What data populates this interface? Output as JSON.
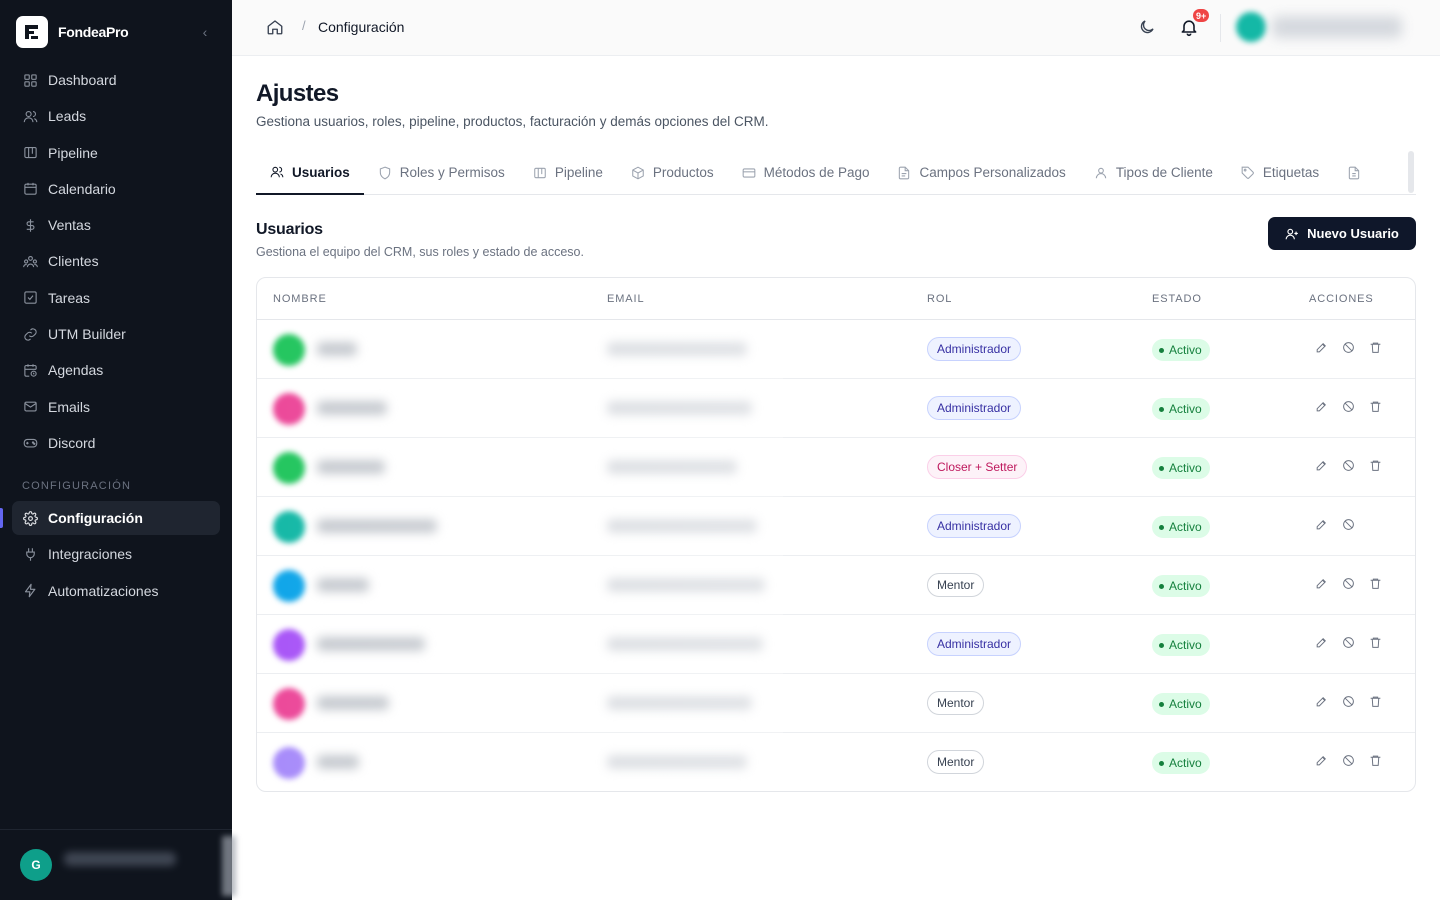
{
  "brand": {
    "name": "FondeaPro",
    "collapse_label": "‹"
  },
  "sidebar": {
    "items": [
      {
        "label": "Dashboard",
        "icon": "layout-grid-icon"
      },
      {
        "label": "Leads",
        "icon": "users-icon"
      },
      {
        "label": "Pipeline",
        "icon": "kanban-icon"
      },
      {
        "label": "Calendario",
        "icon": "calendar-icon"
      },
      {
        "label": "Ventas",
        "icon": "dollar-icon"
      },
      {
        "label": "Clientes",
        "icon": "contacts-icon"
      },
      {
        "label": "Tareas",
        "icon": "checklist-icon"
      },
      {
        "label": "UTM Builder",
        "icon": "link-icon"
      },
      {
        "label": "Agendas",
        "icon": "calendar-clock-icon"
      },
      {
        "label": "Emails",
        "icon": "mail-icon"
      },
      {
        "label": "Discord",
        "icon": "gamepad-icon"
      }
    ],
    "section_label": "CONFIGURACIÓN",
    "config_items": [
      {
        "label": "Configuración",
        "icon": "gear-icon",
        "active": true
      },
      {
        "label": "Integraciones",
        "icon": "plug-icon"
      },
      {
        "label": "Automatizaciones",
        "icon": "lightning-icon"
      }
    ],
    "footer": {
      "avatar_initial": "G"
    }
  },
  "topbar": {
    "breadcrumb_sep": "/",
    "breadcrumb_current": "Configuración",
    "notifications_badge": "9+"
  },
  "page": {
    "title": "Ajustes",
    "subtitle": "Gestiona usuarios, roles, pipeline, productos, facturación y demás opciones del CRM."
  },
  "tabs": [
    {
      "label": "Usuarios",
      "icon": "users-icon",
      "active": true
    },
    {
      "label": "Roles y Permisos",
      "icon": "shield-icon"
    },
    {
      "label": "Pipeline",
      "icon": "kanban-icon"
    },
    {
      "label": "Productos",
      "icon": "box-icon"
    },
    {
      "label": "Métodos de Pago",
      "icon": "credit-card-icon"
    },
    {
      "label": "Campos Personalizados",
      "icon": "file-icon"
    },
    {
      "label": "Tipos de Cliente",
      "icon": "user-icon"
    },
    {
      "label": "Etiquetas",
      "icon": "tag-icon"
    },
    {
      "label": "",
      "icon": "document-icon"
    }
  ],
  "users_section": {
    "title": "Usuarios",
    "subtitle": "Gestiona el equipo del CRM, sus roles y estado de acceso.",
    "new_button": "Nuevo Usuario"
  },
  "table": {
    "headers": {
      "name": "NOMBRE",
      "email": "EMAIL",
      "role": "ROL",
      "status": "ESTADO",
      "actions": "ACCIONES"
    },
    "rows": [
      {
        "role": "Administrador",
        "role_type": "admin",
        "status": "Activo",
        "avatar_color": "#22c55e",
        "name_w": 40,
        "email_w": 140,
        "can_delete": true
      },
      {
        "role": "Administrador",
        "role_type": "admin",
        "status": "Activo",
        "avatar_color": "#ec4899",
        "name_w": 70,
        "email_w": 145,
        "can_delete": true
      },
      {
        "role": "Closer + Setter",
        "role_type": "closer",
        "status": "Activo",
        "avatar_color": "#22c55e",
        "name_w": 68,
        "email_w": 130,
        "can_delete": true
      },
      {
        "role": "Administrador",
        "role_type": "admin",
        "status": "Activo",
        "avatar_color": "#14b8a6",
        "name_w": 120,
        "email_w": 150,
        "can_delete": false
      },
      {
        "role": "Mentor",
        "role_type": "mentor",
        "status": "Activo",
        "avatar_color": "#0ea5e9",
        "name_w": 52,
        "email_w": 158,
        "can_delete": true
      },
      {
        "role": "Administrador",
        "role_type": "admin",
        "status": "Activo",
        "avatar_color": "#a855f7",
        "name_w": 108,
        "email_w": 156,
        "can_delete": true
      },
      {
        "role": "Mentor",
        "role_type": "mentor",
        "status": "Activo",
        "avatar_color": "#ec4899",
        "name_w": 72,
        "email_w": 145,
        "can_delete": true
      },
      {
        "role": "Mentor",
        "role_type": "mentor",
        "status": "Activo",
        "avatar_color": "#a78bfa",
        "name_w": 42,
        "email_w": 140,
        "can_delete": true
      }
    ]
  },
  "colors": {
    "sidebar_bg": "#0f141d",
    "accent": "#6366f1",
    "primary_button": "#0f172a",
    "status_green": "#15803d"
  }
}
